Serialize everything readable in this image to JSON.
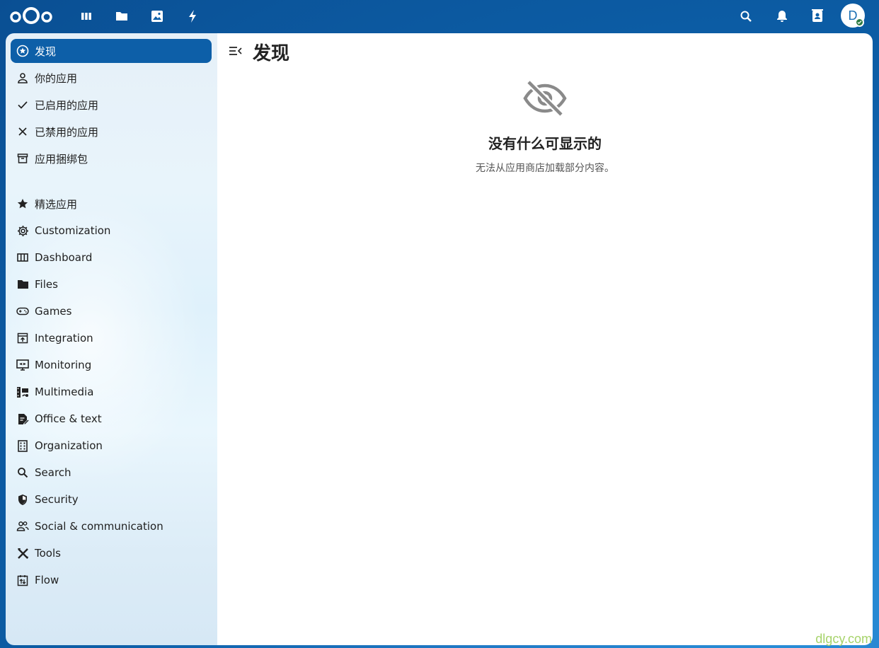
{
  "header": {
    "nav_icons": [
      "dashboard-icon",
      "files-icon",
      "photos-icon",
      "activity-icon"
    ],
    "right_icons": [
      "search-icon",
      "notifications-icon",
      "contacts-icon"
    ],
    "avatar_letter": "D",
    "status": "online",
    "accent": "#0d5fa8"
  },
  "sidebar": {
    "items": [
      {
        "label": "发现",
        "icon": "star-circle-icon",
        "active": true
      },
      {
        "label": "你的应用",
        "icon": "account-icon"
      },
      {
        "label": "已启用的应用",
        "icon": "check-icon"
      },
      {
        "label": "已禁用的应用",
        "icon": "close-icon"
      },
      {
        "label": "应用捆绑包",
        "icon": "archive-icon"
      },
      {
        "label": "精选应用",
        "icon": "star-icon"
      },
      {
        "label": "Customization",
        "icon": "cog-icon"
      },
      {
        "label": "Dashboard",
        "icon": "view-column-icon"
      },
      {
        "label": "Files",
        "icon": "folder-icon"
      },
      {
        "label": "Games",
        "icon": "gamepad-icon"
      },
      {
        "label": "Integration",
        "icon": "integration-icon"
      },
      {
        "label": "Monitoring",
        "icon": "monitor-eye-icon"
      },
      {
        "label": "Multimedia",
        "icon": "multimedia-icon"
      },
      {
        "label": "Office & text",
        "icon": "file-document-edit-icon"
      },
      {
        "label": "Organization",
        "icon": "office-building-icon"
      },
      {
        "label": "Search",
        "icon": "magnify-icon"
      },
      {
        "label": "Security",
        "icon": "shield-icon"
      },
      {
        "label": "Social & communication",
        "icon": "account-multiple-icon"
      },
      {
        "label": "Tools",
        "icon": "tools-icon"
      },
      {
        "label": "Flow",
        "icon": "flow-icon"
      }
    ]
  },
  "main": {
    "title": "发现",
    "empty_state": {
      "icon": "eye-off-icon",
      "title": "没有什么可显示的",
      "description": "无法从应用商店加载部分内容。"
    }
  },
  "watermark": "dlgcy.com"
}
